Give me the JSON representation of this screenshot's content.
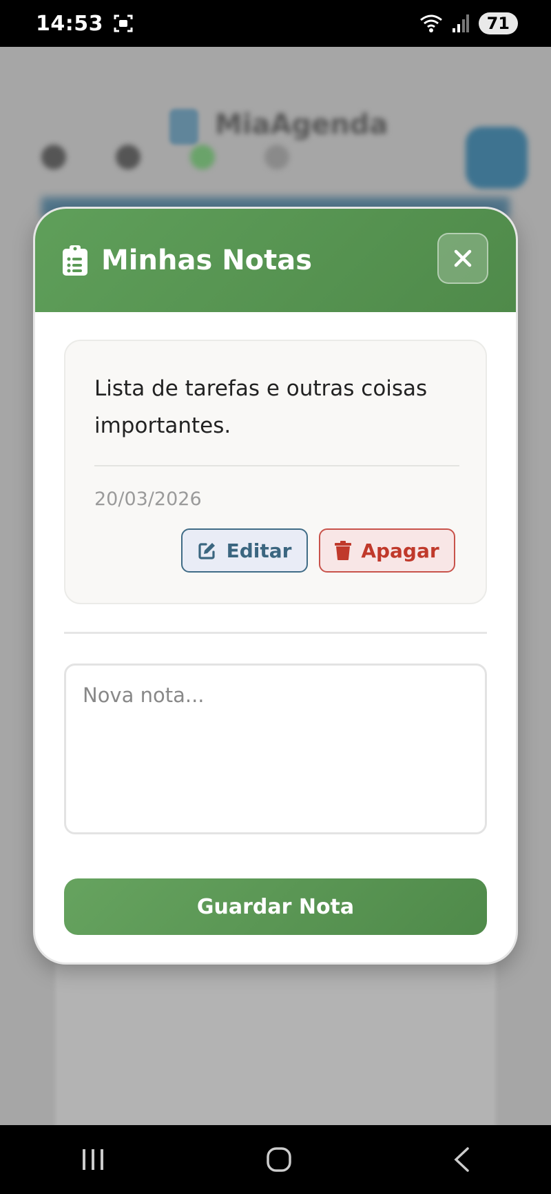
{
  "status_bar": {
    "time": "14:53",
    "battery": "71"
  },
  "background": {
    "app_name": "MiaAgenda"
  },
  "modal": {
    "title": "Minhas Notas",
    "notes": [
      {
        "text": "Lista de tarefas e outras coisas importantes.",
        "date": "20/03/2026",
        "edit_label": "Editar",
        "delete_label": "Apagar"
      }
    ],
    "input": {
      "placeholder": "Nova nota...",
      "value": ""
    },
    "save_label": "Guardar Nota"
  },
  "colors": {
    "header_green": "#5f9f5a",
    "edit_blue": "#3b6680",
    "delete_red": "#c0392b"
  },
  "icons": {
    "header": "clipboard-list-icon",
    "close": "close-icon",
    "edit": "edit-icon",
    "delete": "trash-icon"
  }
}
